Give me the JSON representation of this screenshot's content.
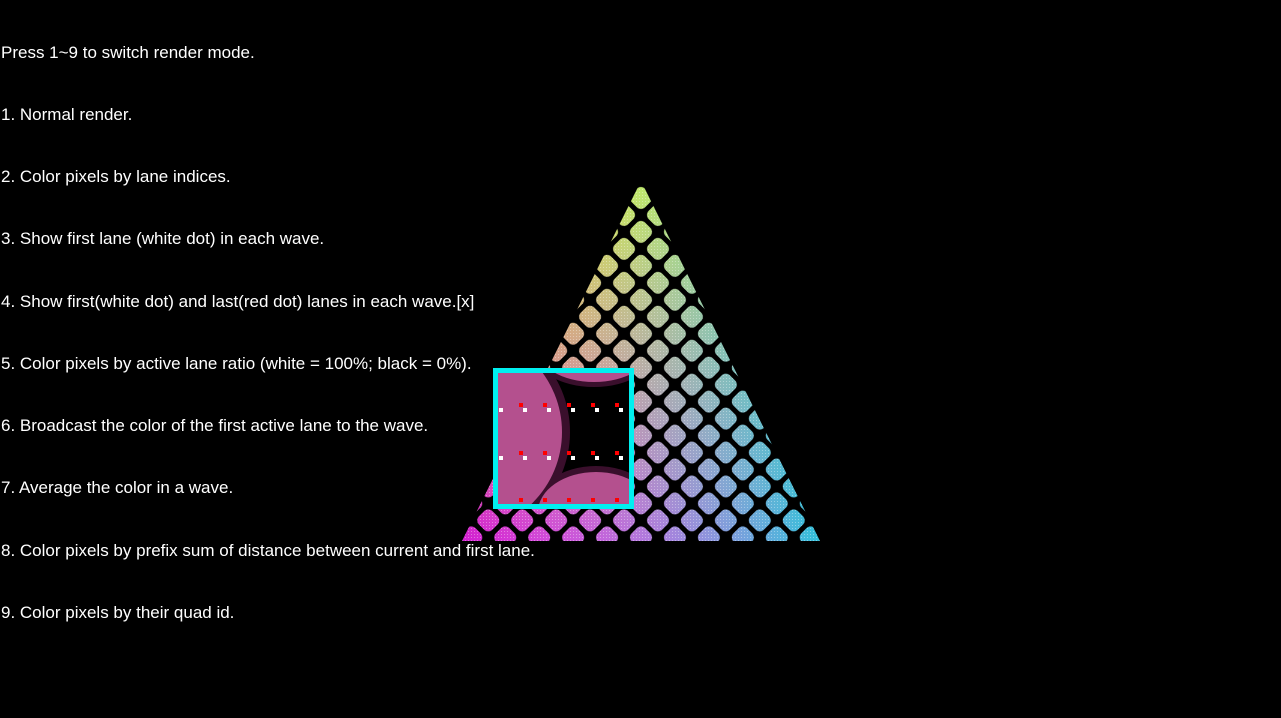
{
  "instructions": {
    "header": "Press 1~9 to switch render mode.",
    "modes": [
      "1. Normal render.",
      "2. Color pixels by lane indices.",
      "3. Show first lane (white dot) in each wave.",
      "4. Show first(white dot) and last(red dot) lanes in each wave.[x]",
      "5. Color pixels by active lane ratio (white = 100%; black = 0%).",
      "6. Broadcast the color of the first active lane to the wave.",
      "7. Average the color in a wave.",
      "8. Color pixels by prefix sum of distance between current and first lane.",
      "9. Color pixels by their quad id."
    ]
  },
  "scene": {
    "triangle": {
      "vertex_colors": [
        "#e6e60a",
        "#d21ed2",
        "#14dcdc"
      ]
    },
    "magnifier": {
      "border_color": "#00f0f0",
      "fill_color": "#b4508e",
      "first_lane_dot_color": "#ffffff",
      "last_lane_dot_color": "#ff0000"
    }
  }
}
